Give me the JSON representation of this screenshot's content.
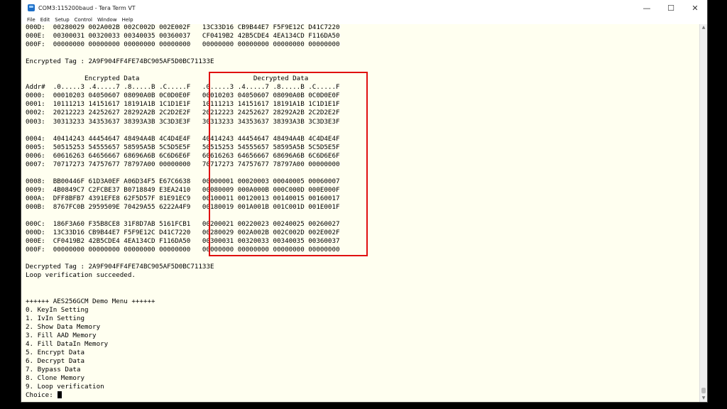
{
  "window": {
    "title": "COM3:115200baud - Tera Term VT",
    "minimize_icon": "minimize-icon",
    "maximize_icon": "maximize-icon",
    "close_icon": "close-icon"
  },
  "menu": [
    "File",
    "Edit",
    "Setup",
    "Control",
    "Window",
    "Help"
  ],
  "terminal": {
    "lines": [
      "000D:  00280029 002A002B 002C002D 002E002F   13C33D16 CB9B44E7 F5F9E12C D41C7220",
      "000E:  00300031 00320033 00340035 00360037   CF0419B2 42B5CDE4 4EA134CD F116DA50",
      "000F:  00000000 00000000 00000000 00000000   00000000 00000000 00000000 00000000",
      "",
      "Encrypted Tag : 2A9F904FF4FE74BC905AF5D0BC71133E",
      "",
      "               Encrypted Data                             Decrypted Data",
      "Addr#  .0.....3 .4.....7 .8.....B .C.....F   .0.....3 .4.....7 .8.....B .C.....F",
      "0000:  00010203 04050607 08090A0B 0C0D0E0F   00010203 04050607 08090A0B 0C0D0E0F",
      "0001:  10111213 14151617 18191A1B 1C1D1E1F   10111213 14151617 18191A1B 1C1D1E1F",
      "0002:  20212223 24252627 28292A2B 2C2D2E2F   20212223 24252627 28292A2B 2C2D2E2F",
      "0003:  30313233 34353637 38393A3B 3C3D3E3F   30313233 34353637 38393A3B 3C3D3E3F",
      "",
      "0004:  40414243 44454647 48494A4B 4C4D4E4F   40414243 44454647 48494A4B 4C4D4E4F",
      "0005:  50515253 54555657 58595A5B 5C5D5E5F   50515253 54555657 58595A5B 5C5D5E5F",
      "0006:  60616263 64656667 68696A6B 6C6D6E6F   60616263 64656667 68696A6B 6C6D6E6F",
      "0007:  70717273 74757677 78797A00 00000000   70717273 74757677 78797A00 00000000",
      "",
      "0008:  BB00446F 61D3A0EF A06D34F5 E67C6638   00000001 00020003 00040005 00060007",
      "0009:  4B0849C7 C2FCBE37 B0718849 E3EA2410   00080009 000A000B 000C000D 000E000F",
      "000A:  DFF8BFB7 4391EFE8 62F5D57F 81E91EC9   00100011 00120013 00140015 00160017",
      "000B:  8767FC0B 2959509E 70429A55 6222A4F9   00180019 001A001B 001C001D 001E001F",
      "",
      "000C:  186F3A60 F35B8CE8 31F8D7AB 5161FCB1   00200021 00220023 00240025 00260027",
      "000D:  13C33D16 CB9B44E7 F5F9E12C D41C7220   00280029 002A002B 002C002D 002E002F",
      "000E:  CF0419B2 42B5CDE4 4EA134CD F116DA50   00300031 00320033 00340035 00360037",
      "000F:  00000000 00000000 00000000 00000000   00000000 00000000 00000000 00000000",
      "",
      "Decrypted Tag : 2A9F904FF4FE74BC905AF5D0BC71133E",
      "Loop verification succeeded.",
      "",
      "",
      "++++++ AES256GCM Demo Menu ++++++",
      "0. KeyIn Setting",
      "1. IvIn Setting",
      "2. Show Data Memory",
      "3. Fill AAD Memory",
      "4. Fill DataIn Memory",
      "5. Encrypt Data",
      "6. Decrypt Data",
      "7. Bypass Data",
      "8. Clone Memory",
      "9. Loop verification",
      "Choice: "
    ]
  },
  "highlight": {
    "color": "#e01010",
    "label": "decrypted-data-region"
  }
}
